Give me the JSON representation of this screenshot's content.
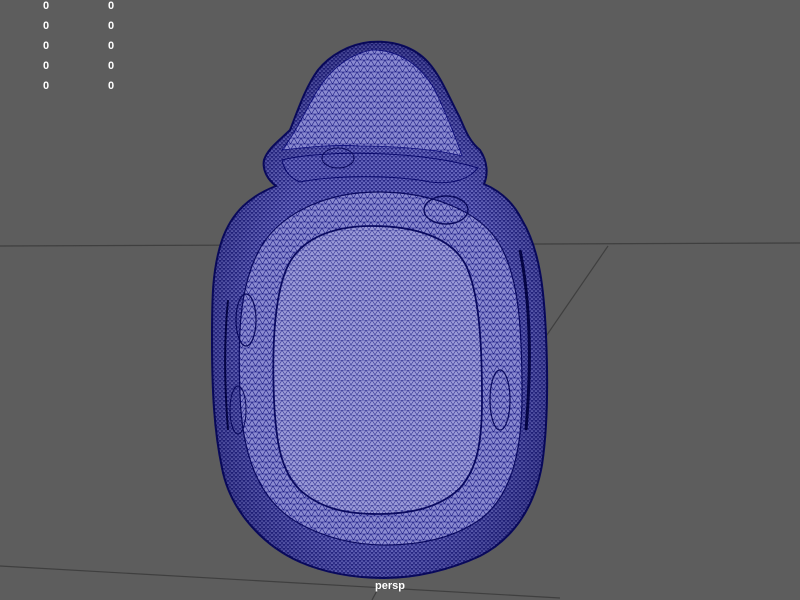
{
  "viewport": {
    "camera_name": "persp",
    "background_color": "#5d5d5d",
    "grid_line_color": "#3f3f3f",
    "wireframe_color": "#0d0d7a",
    "mesh_fill_color": "#8a8ad0"
  },
  "hud": {
    "rows": [
      {
        "col1": "0",
        "col2": "0"
      },
      {
        "col1": "0",
        "col2": "0"
      },
      {
        "col1": "0",
        "col2": "0"
      },
      {
        "col1": "0",
        "col2": "0"
      },
      {
        "col1": "0",
        "col2": "0"
      }
    ]
  },
  "mesh": {
    "display_mode": "wireframe-on-shaded"
  }
}
